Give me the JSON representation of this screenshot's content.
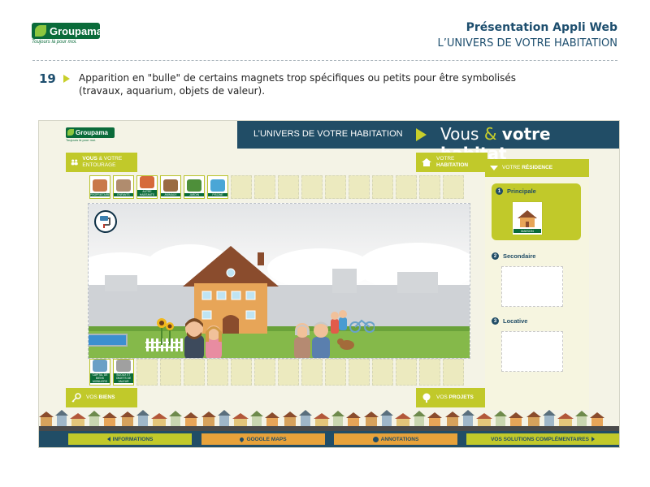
{
  "header": {
    "logo_text": "Groupama",
    "logo_tagline": "Toujours là pour moi.",
    "title_line1": "Présentation Appli Web",
    "title_line2": "L’UNIVERS DE VOTRE HABITATION"
  },
  "slide": {
    "number": "19",
    "text_line1": "Apparition en \"bulle\" de certains magnets trop spécifiques ou petits pour être symbolisés",
    "text_line2": "(travaux, aquarium, objets de valeur)."
  },
  "app": {
    "logo_text": "Groupama",
    "logo_tagline": "Toujours là pour moi.",
    "banner_left": "L’UNIVERS DE VOTRE HABITATION",
    "banner_right_prefix": "Vous",
    "banner_amp": "&",
    "banner_right_bold": "votre habitat",
    "sections": {
      "entourage_bold": "VOUS",
      "entourage_rest": "& VOTRE ENTOURAGE",
      "habitation_l1": "VOTRE",
      "habitation_l2": "HABITATION",
      "biens_prefix": "VOS",
      "biens_bold": "BIENS",
      "projets_prefix": "VOS",
      "projets_bold": "PROJETS"
    },
    "top_magnets": [
      {
        "label": "PROPRIETAIRE",
        "color": "#c9784a"
      },
      {
        "label": "ENFANTS",
        "color": "#b08c6e"
      },
      {
        "label": "AUTRE HABITANTS",
        "color": "#d66a3b"
      },
      {
        "label": "ANIMAUX",
        "color": "#9a6b43"
      },
      {
        "label": "JARDIN",
        "color": "#4e8f3a"
      },
      {
        "label": "PISCINE",
        "color": "#4aa6d6"
      }
    ],
    "bottom_magnets": [
      {
        "label": "CAPITAL DE BIENS MOBILIERS",
        "color": "#6aa0c6"
      },
      {
        "label": "BIJOUX ET OBJETS DE VALEUR",
        "color": "#a0a0a0"
      }
    ],
    "residence": {
      "header_prefix": "VOTRE",
      "header_bold": "RÉSIDENCE",
      "items": [
        {
          "num": "1",
          "label": "Principale",
          "magnet": "MAISON"
        },
        {
          "num": "2",
          "label": "Secondaire"
        },
        {
          "num": "3",
          "label": "Locative"
        }
      ]
    },
    "nav": [
      {
        "label": "INFORMATIONS",
        "icon": "chevron-left-icon"
      },
      {
        "label": "GOOGLE MAPS",
        "icon": "map-pin-icon"
      },
      {
        "label": "ANNOTATIONS",
        "icon": "pencil-icon"
      },
      {
        "label": "VOS SOLUTIONS COMPLÉMENTAIRES",
        "icon": "chevron-right-icon"
      }
    ]
  }
}
